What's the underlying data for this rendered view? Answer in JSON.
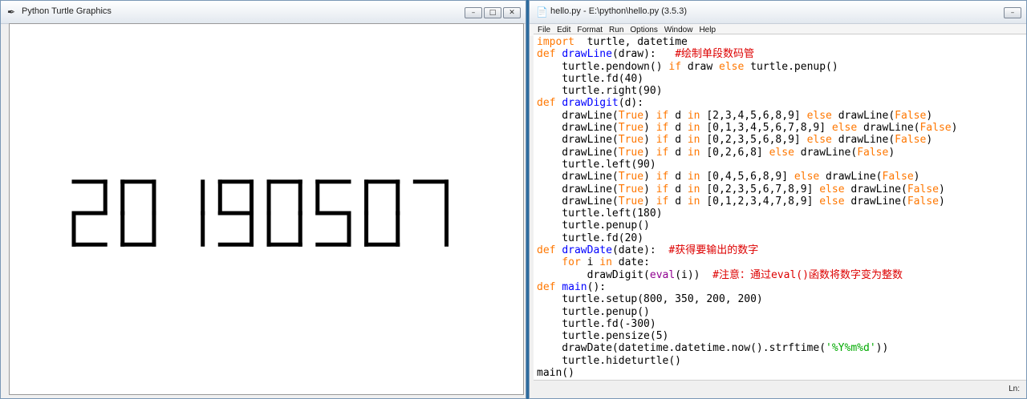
{
  "turtle_window": {
    "title": "Python Turtle Graphics",
    "digits": "20190507",
    "buttons": {
      "minimize": "–",
      "maximize": "□",
      "close": "✕"
    }
  },
  "idle_window": {
    "title": "hello.py - E:\\python\\hello.py (3.5.3)",
    "buttons": {
      "minimize": "–"
    },
    "menu": [
      "File",
      "Edit",
      "Format",
      "Run",
      "Options",
      "Window",
      "Help"
    ],
    "code_lines": [
      [
        [
          "kw",
          "import"
        ],
        [
          "",
          "  turtle, datetime"
        ]
      ],
      [
        [
          "kw",
          "def "
        ],
        [
          "fn",
          "drawLine"
        ],
        [
          "",
          "(draw):   "
        ],
        [
          "cm",
          "#绘制单段数码管"
        ]
      ],
      [
        [
          "",
          "    turtle.pendown() "
        ],
        [
          "kw",
          "if"
        ],
        [
          "",
          " draw "
        ],
        [
          "kw",
          "else"
        ],
        [
          "",
          " turtle.penup()"
        ]
      ],
      [
        [
          "",
          "    turtle.fd(40)"
        ]
      ],
      [
        [
          "",
          "    turtle.right(90)"
        ]
      ],
      [
        [
          "kw",
          "def "
        ],
        [
          "fn",
          "drawDigit"
        ],
        [
          "",
          "(d):"
        ]
      ],
      [
        [
          "",
          "    drawLine("
        ],
        [
          "kw",
          "True"
        ],
        [
          "",
          ") "
        ],
        [
          "kw",
          "if"
        ],
        [
          "",
          " d "
        ],
        [
          "kw",
          "in"
        ],
        [
          "",
          " [2,3,4,5,6,8,9] "
        ],
        [
          "kw",
          "else"
        ],
        [
          "",
          " drawLine("
        ],
        [
          "kw",
          "False"
        ],
        [
          "",
          ")"
        ]
      ],
      [
        [
          "",
          "    drawLine("
        ],
        [
          "kw",
          "True"
        ],
        [
          "",
          ") "
        ],
        [
          "kw",
          "if"
        ],
        [
          "",
          " d "
        ],
        [
          "kw",
          "in"
        ],
        [
          "",
          " [0,1,3,4,5,6,7,8,9] "
        ],
        [
          "kw",
          "else"
        ],
        [
          "",
          " drawLine("
        ],
        [
          "kw",
          "False"
        ],
        [
          "",
          ")"
        ]
      ],
      [
        [
          "",
          "    drawLine("
        ],
        [
          "kw",
          "True"
        ],
        [
          "",
          ") "
        ],
        [
          "kw",
          "if"
        ],
        [
          "",
          " d "
        ],
        [
          "kw",
          "in"
        ],
        [
          "",
          " [0,2,3,5,6,8,9] "
        ],
        [
          "kw",
          "else"
        ],
        [
          "",
          " drawLine("
        ],
        [
          "kw",
          "False"
        ],
        [
          "",
          ")"
        ]
      ],
      [
        [
          "",
          "    drawLine("
        ],
        [
          "kw",
          "True"
        ],
        [
          "",
          ") "
        ],
        [
          "kw",
          "if"
        ],
        [
          "",
          " d "
        ],
        [
          "kw",
          "in"
        ],
        [
          "",
          " [0,2,6,8] "
        ],
        [
          "kw",
          "else"
        ],
        [
          "",
          " drawLine("
        ],
        [
          "kw",
          "False"
        ],
        [
          "",
          ")"
        ]
      ],
      [
        [
          "",
          "    turtle.left(90)"
        ]
      ],
      [
        [
          "",
          "    drawLine("
        ],
        [
          "kw",
          "True"
        ],
        [
          "",
          ") "
        ],
        [
          "kw",
          "if"
        ],
        [
          "",
          " d "
        ],
        [
          "kw",
          "in"
        ],
        [
          "",
          " [0,4,5,6,8,9] "
        ],
        [
          "kw",
          "else"
        ],
        [
          "",
          " drawLine("
        ],
        [
          "kw",
          "False"
        ],
        [
          "",
          ")"
        ]
      ],
      [
        [
          "",
          "    drawLine("
        ],
        [
          "kw",
          "True"
        ],
        [
          "",
          ") "
        ],
        [
          "kw",
          "if"
        ],
        [
          "",
          " d "
        ],
        [
          "kw",
          "in"
        ],
        [
          "",
          " [0,2,3,5,6,7,8,9] "
        ],
        [
          "kw",
          "else"
        ],
        [
          "",
          " drawLine("
        ],
        [
          "kw",
          "False"
        ],
        [
          "",
          ")"
        ]
      ],
      [
        [
          "",
          "    drawLine("
        ],
        [
          "kw",
          "True"
        ],
        [
          "",
          ") "
        ],
        [
          "kw",
          "if"
        ],
        [
          "",
          " d "
        ],
        [
          "kw",
          "in"
        ],
        [
          "",
          " [0,1,2,3,4,7,8,9] "
        ],
        [
          "kw",
          "else"
        ],
        [
          "",
          " drawLine("
        ],
        [
          "kw",
          "False"
        ],
        [
          "",
          ")"
        ]
      ],
      [
        [
          "",
          "    turtle.left(180)"
        ]
      ],
      [
        [
          "",
          "    turtle.penup()"
        ]
      ],
      [
        [
          "",
          "    turtle.fd(20)"
        ]
      ],
      [
        [
          "kw",
          "def "
        ],
        [
          "fn",
          "drawDate"
        ],
        [
          "",
          "(date):  "
        ],
        [
          "cm",
          "#获得要输出的数字"
        ]
      ],
      [
        [
          "kw",
          "    for"
        ],
        [
          "",
          " i "
        ],
        [
          "kw",
          "in"
        ],
        [
          "",
          " date:"
        ]
      ],
      [
        [
          "",
          "        drawDigit("
        ],
        [
          "bi",
          "eval"
        ],
        [
          "",
          "(i))  "
        ],
        [
          "cm",
          "#注意：通过eval()函数将数字变为整数"
        ]
      ],
      [
        [
          "kw",
          "def "
        ],
        [
          "fn",
          "main"
        ],
        [
          "",
          "():"
        ]
      ],
      [
        [
          "",
          "    turtle.setup(800, 350, 200, 200)"
        ]
      ],
      [
        [
          "",
          "    turtle.penup()"
        ]
      ],
      [
        [
          "",
          "    turtle.fd(-300)"
        ]
      ],
      [
        [
          "",
          "    turtle.pensize(5)"
        ]
      ],
      [
        [
          "",
          "    drawDate(datetime.datetime.now().strftime("
        ],
        [
          "st",
          "'%Y%m%d'"
        ],
        [
          "",
          "))"
        ]
      ],
      [
        [
          "",
          "    turtle.hideturtle()"
        ]
      ],
      [
        [
          "",
          "main()"
        ]
      ]
    ],
    "status": "Ln:"
  },
  "colors": {
    "keyword": "#ff7700",
    "function_name": "#0000ff",
    "comment": "#dd0000",
    "string": "#00aa00",
    "builtin": "#900090",
    "segment": "#000000"
  }
}
